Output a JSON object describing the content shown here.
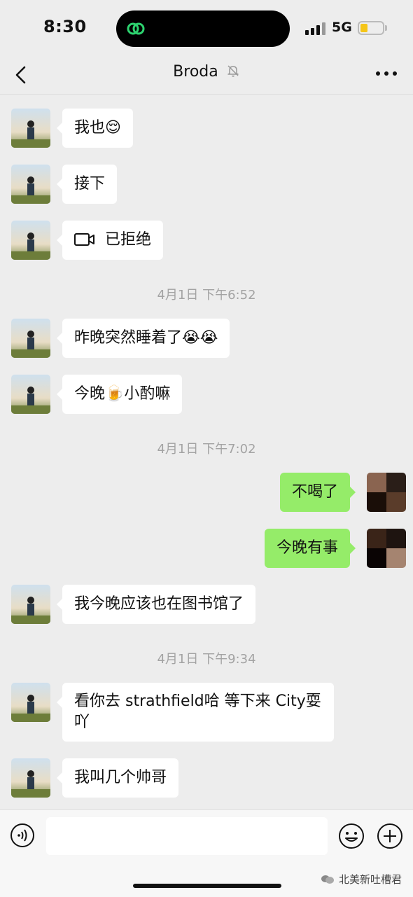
{
  "status_bar": {
    "time": "8:30",
    "network": "5G"
  },
  "header": {
    "title": "Broda"
  },
  "colors": {
    "outgoing_bubble": "#95ec69",
    "incoming_bubble": "#ffffff",
    "background": "#ededed"
  },
  "messages": [
    {
      "side": "left",
      "text": "我也😌"
    },
    {
      "side": "left",
      "text": "接下"
    },
    {
      "side": "left",
      "text": "已拒绝",
      "icon": "video-call-icon"
    },
    {
      "type": "timestamp",
      "text": "4月1日 下午6:52"
    },
    {
      "side": "left",
      "text": "昨晚突然睡着了😭😭"
    },
    {
      "side": "left",
      "text": "今晚🍺小酌嘛"
    },
    {
      "type": "timestamp",
      "text": "4月1日 下午7:02"
    },
    {
      "side": "right",
      "text": "不喝了"
    },
    {
      "side": "right",
      "text": "今晚有事"
    },
    {
      "side": "left",
      "text": "我今晚应该也在图书馆了"
    },
    {
      "type": "timestamp",
      "text": "4月1日 下午9:34"
    },
    {
      "side": "left",
      "text": "看你去 strathfield哈 等下来 City耍吖"
    },
    {
      "side": "left",
      "text": "我叫几个帅哥"
    }
  ],
  "input_bar": {
    "value": ""
  },
  "watermark": "北美新吐槽君"
}
